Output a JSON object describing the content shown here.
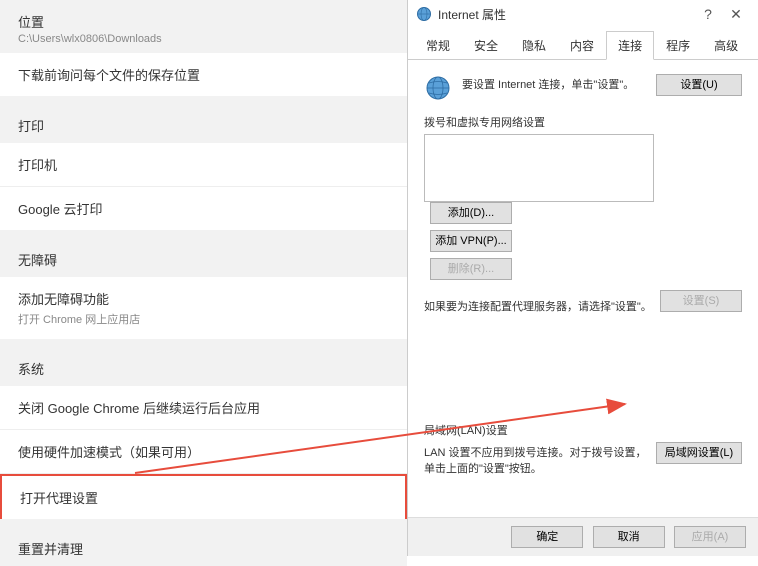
{
  "settings": {
    "location": {
      "header": "位置",
      "path": "C:\\Users\\wlx0806\\Downloads",
      "ask_before": "下载前询问每个文件的保存位置"
    },
    "print": {
      "header": "打印",
      "printer": "打印机",
      "cloud_print": "Google 云打印"
    },
    "accessibility": {
      "header": "无障碍",
      "add_features": "添加无障碍功能",
      "open_store": "打开 Chrome 网上应用店"
    },
    "system": {
      "header": "系统",
      "background": "关闭 Google Chrome 后继续运行后台应用",
      "hw_accel": "使用硬件加速模式（如果可用）",
      "proxy": "打开代理设置"
    },
    "reset": {
      "header": "重置并清理"
    }
  },
  "dialog": {
    "title": "Internet 属性",
    "help": "?",
    "close": "✕",
    "tabs": {
      "general": "常规",
      "security": "安全",
      "privacy": "隐私",
      "content": "内容",
      "connections": "连接",
      "programs": "程序",
      "advanced": "高级"
    },
    "setup_text": "要设置 Internet 连接，单击\"设置\"。",
    "setup_btn": "设置(U)",
    "dialup_label": "拨号和虚拟专用网络设置",
    "add_btn": "添加(D)...",
    "add_vpn_btn": "添加 VPN(P)...",
    "remove_btn": "删除(R)...",
    "settings_btn": "设置(S)",
    "proxy_note": "如果要为连接配置代理服务器，请选择\"设置\"。",
    "lan_label": "局域网(LAN)设置",
    "lan_note": "LAN 设置不应用到拨号连接。对于拨号设置，单击上面的\"设置\"按钮。",
    "lan_btn": "局域网设置(L)",
    "ok": "确定",
    "cancel": "取消",
    "apply": "应用(A)"
  }
}
